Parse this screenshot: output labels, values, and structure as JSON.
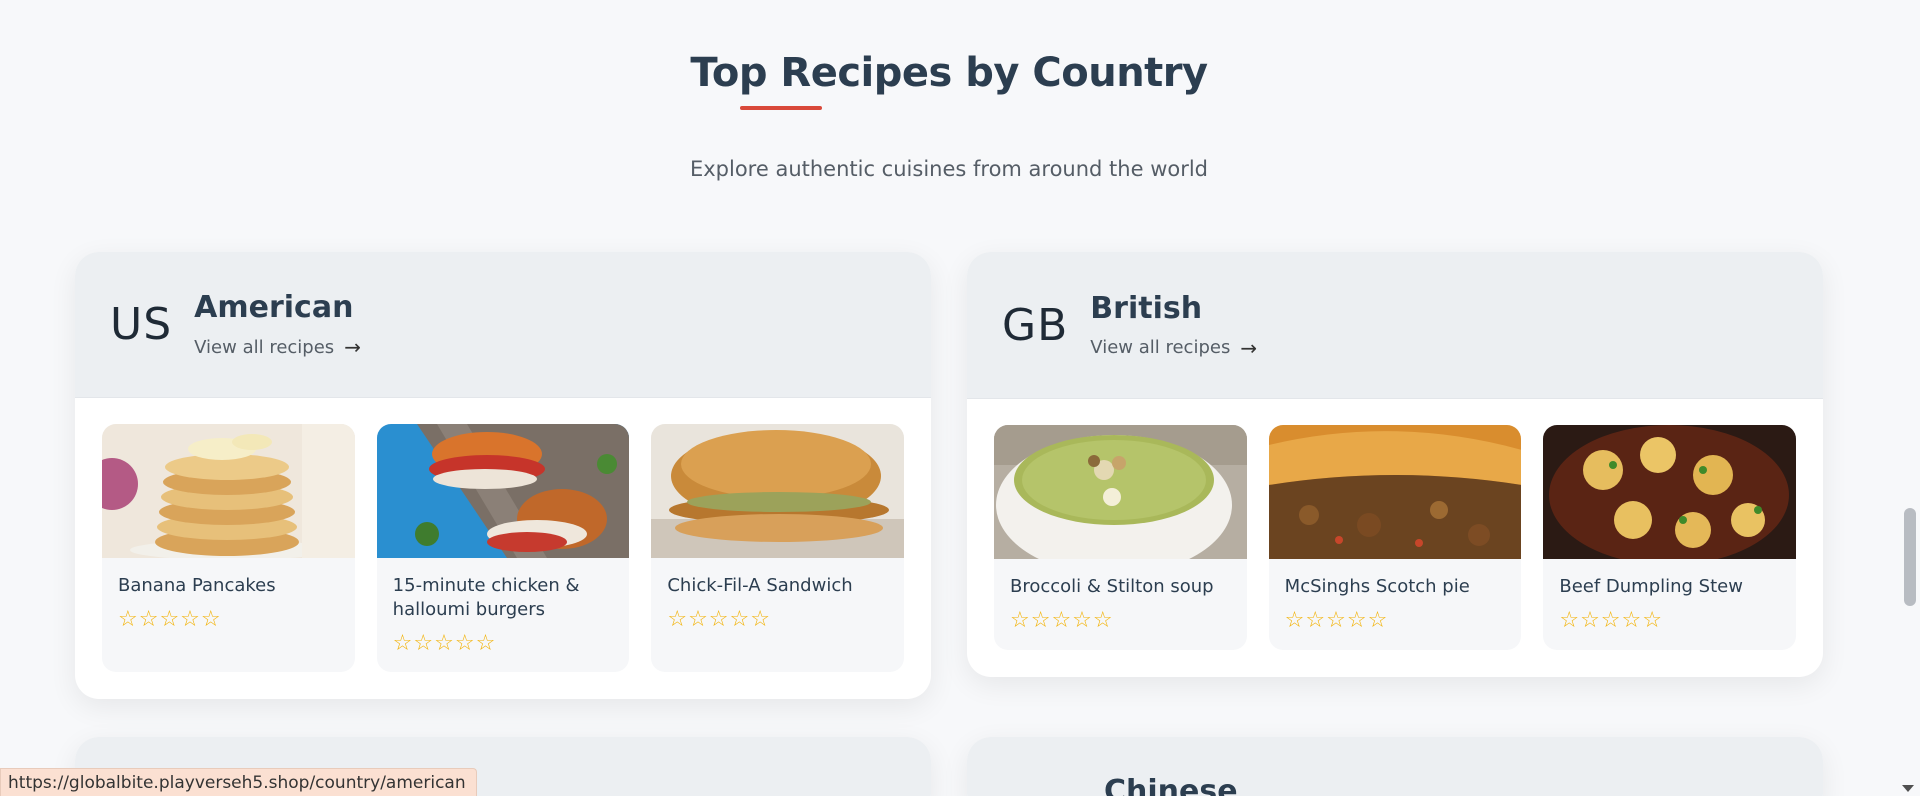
{
  "section": {
    "title": "Top Recipes by Country",
    "subtitle": "Explore authentic cuisines from around the world",
    "accent_color": "#d9493a"
  },
  "countries": [
    {
      "code": "US",
      "name": "American",
      "view_all": "View all recipes",
      "recipes": [
        {
          "title": "Banana Pancakes",
          "rating": "☆☆☆☆☆"
        },
        {
          "title": "15-minute chicken & halloumi burgers",
          "rating": "☆☆☆☆☆"
        },
        {
          "title": "Chick-Fil-A Sandwich",
          "rating": "☆☆☆☆☆"
        }
      ]
    },
    {
      "code": "GB",
      "name": "British",
      "view_all": "View all recipes",
      "recipes": [
        {
          "title": "Broccoli & Stilton soup",
          "rating": "☆☆☆☆☆"
        },
        {
          "title": "McSinghs Scotch pie",
          "rating": "☆☆☆☆☆"
        },
        {
          "title": "Beef Dumpling Stew",
          "rating": "☆☆☆☆☆"
        }
      ]
    },
    {
      "code": "",
      "name": "",
      "view_all": "",
      "recipes": []
    },
    {
      "code": "",
      "name": "Chinese",
      "view_all": "",
      "recipes": []
    }
  ],
  "status_bar": {
    "url": "https://globalbite.playverseh5.shop/country/american"
  },
  "icons": {
    "arrow": "arrow-right-icon",
    "star": "star-outline-icon"
  },
  "colors": {
    "star": "#f2b40c",
    "title": "#2c3e50",
    "header_bg": "#eceff2"
  }
}
